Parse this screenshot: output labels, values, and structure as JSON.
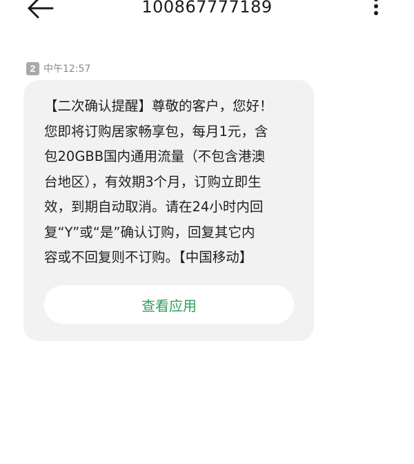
{
  "header": {
    "back_icon": "arrow-left-icon",
    "title": "100867777189",
    "more_icon": "more-vertical-icon"
  },
  "message": {
    "sim_slot": "2",
    "time": "中午12:57",
    "lines": [
      "【二次确认提醒】尊敬的客户，您好！",
      "您即将订购居家畅享包，每月1元，含",
      "包20GBB国内通用流量（不包含港澳",
      "台地区），有效期3个月，订购立即生",
      "效，到期自动取消。请在24小时内回",
      "复“Y”或“是”确认订购，回复其它内",
      "容或不回复则不订购。【中国移动】"
    ],
    "action_label": "查看应用"
  },
  "colors": {
    "bubble_bg": "#f2f2f2",
    "action_text": "#2f9e5b",
    "badge_bg": "#a9a9a9",
    "meta_text": "#888888"
  }
}
